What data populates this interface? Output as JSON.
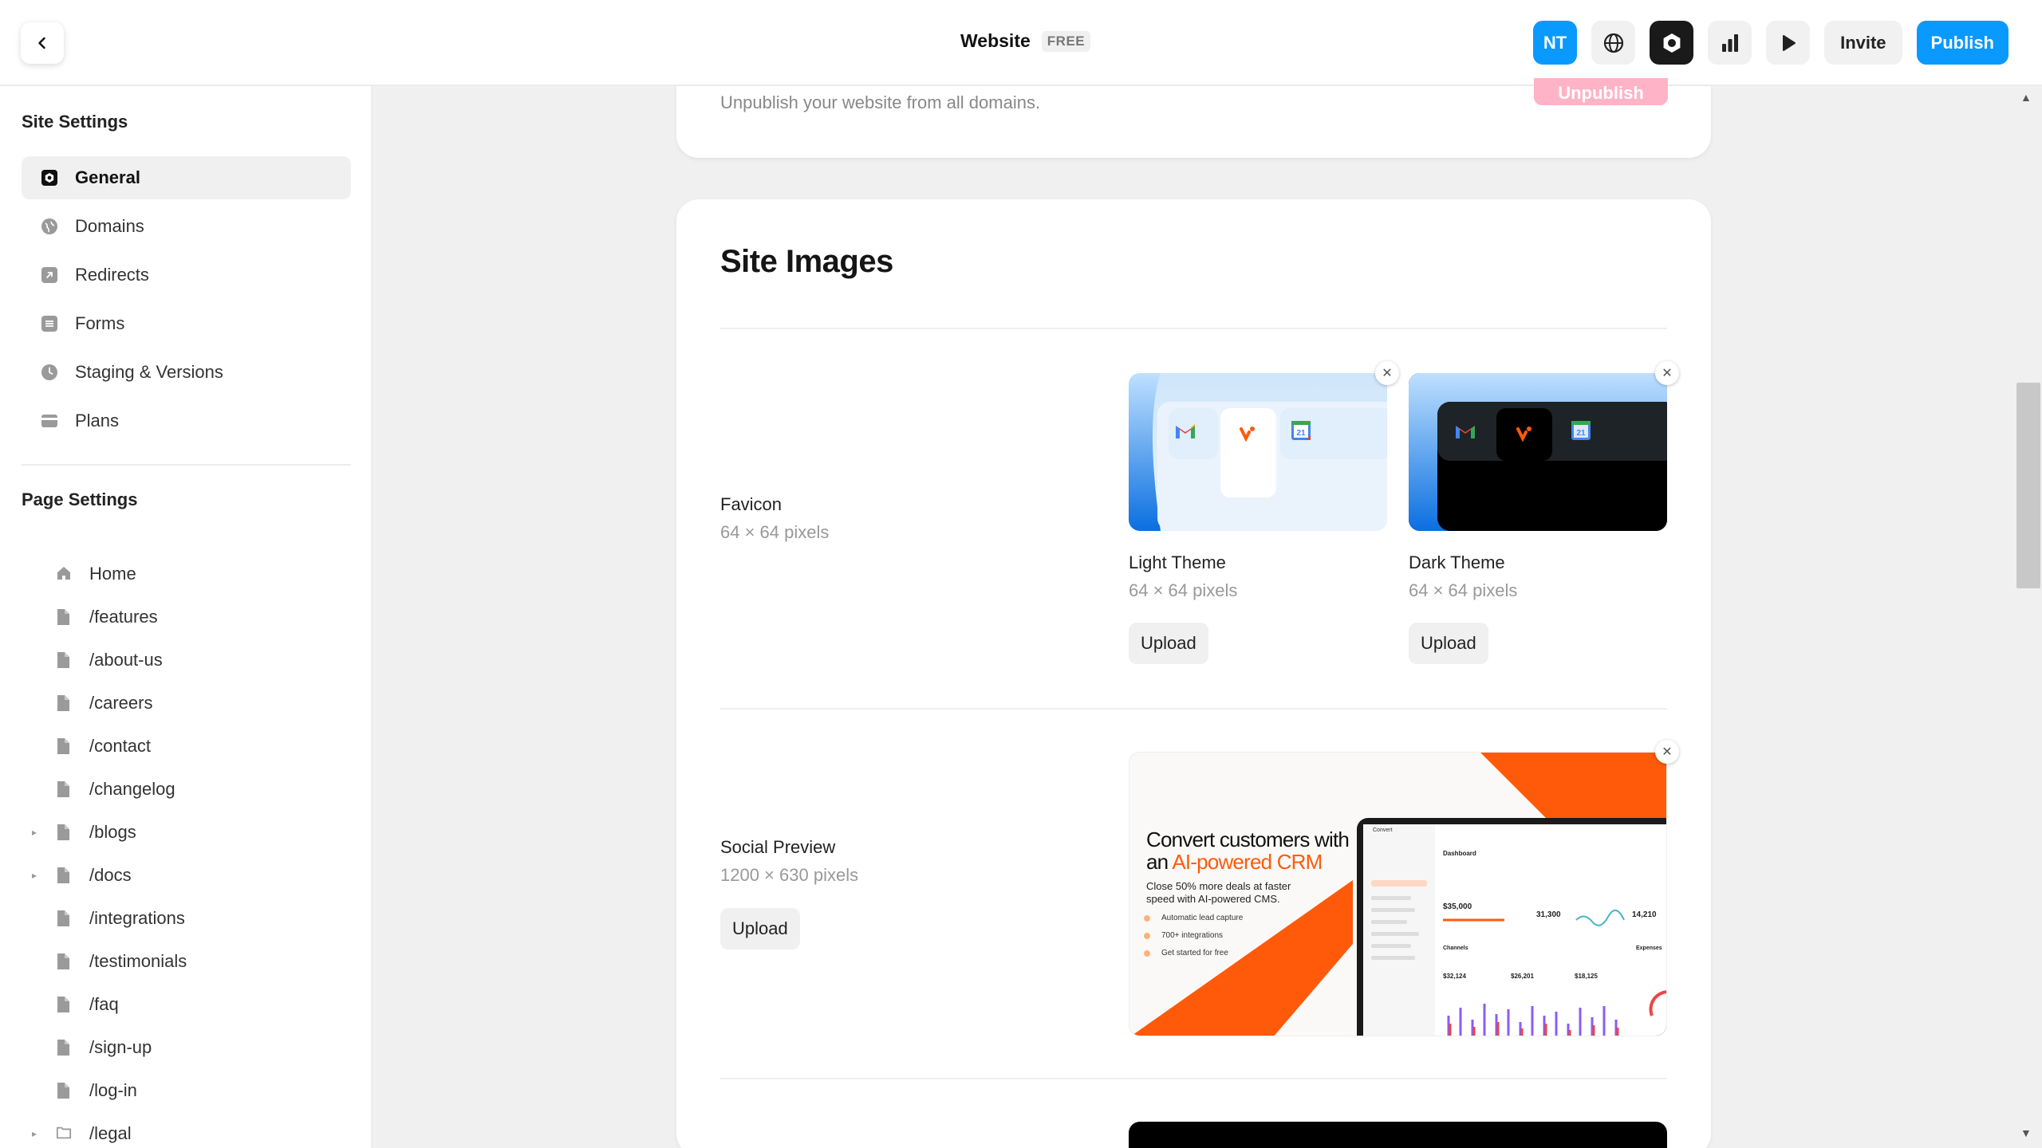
{
  "topbar": {
    "title": "Website",
    "plan_badge": "FREE",
    "avatar_initials": "NT",
    "invite_label": "Invite",
    "publish_label": "Publish"
  },
  "sidebar": {
    "site_settings_title": "Site Settings",
    "site_items": [
      {
        "label": "General",
        "icon": "gear-icon",
        "active": true
      },
      {
        "label": "Domains",
        "icon": "globe-icon"
      },
      {
        "label": "Redirects",
        "icon": "redirect-icon"
      },
      {
        "label": "Forms",
        "icon": "form-icon"
      },
      {
        "label": "Staging & Versions",
        "icon": "clock-icon"
      },
      {
        "label": "Plans",
        "icon": "card-icon"
      }
    ],
    "page_settings_title": "Page Settings",
    "pages": [
      {
        "label": "Home",
        "icon": "home-icon",
        "expandable": false
      },
      {
        "label": "/features",
        "icon": "page-icon",
        "expandable": false
      },
      {
        "label": "/about-us",
        "icon": "page-icon",
        "expandable": false
      },
      {
        "label": "/careers",
        "icon": "page-icon",
        "expandable": false
      },
      {
        "label": "/contact",
        "icon": "page-icon",
        "expandable": false
      },
      {
        "label": "/changelog",
        "icon": "page-icon",
        "expandable": false
      },
      {
        "label": "/blogs",
        "icon": "page-icon",
        "expandable": true
      },
      {
        "label": "/docs",
        "icon": "page-icon",
        "expandable": true
      },
      {
        "label": "/integrations",
        "icon": "page-icon",
        "expandable": false
      },
      {
        "label": "/testimonials",
        "icon": "page-icon",
        "expandable": false
      },
      {
        "label": "/faq",
        "icon": "page-icon",
        "expandable": false
      },
      {
        "label": "/sign-up",
        "icon": "page-icon",
        "expandable": false
      },
      {
        "label": "/log-in",
        "icon": "page-icon",
        "expandable": false
      },
      {
        "label": "/legal",
        "icon": "folder-icon",
        "expandable": true
      }
    ]
  },
  "unpublish": {
    "description": "Unpublish your website from all domains.",
    "button_label": "Unpublish"
  },
  "site_images": {
    "title": "Site Images",
    "favicon": {
      "label": "Favicon",
      "size": "64 × 64 pixels",
      "light": {
        "label": "Light Theme",
        "size": "64 × 64 pixels",
        "upload": "Upload"
      },
      "dark": {
        "label": "Dark Theme",
        "size": "64 × 64 pixels",
        "upload": "Upload"
      }
    },
    "social": {
      "label": "Social Preview",
      "size": "1200 × 630 pixels",
      "upload": "Upload",
      "preview": {
        "headline_1": "Convert customers with",
        "headline_2a": "an ",
        "headline_2b": "AI-powered CRM",
        "subline_1": "Close 50% more deals at faster",
        "subline_2": "speed with AI-powered CMS.",
        "bullets": [
          "Automatic lead capture",
          "700+ integrations",
          "Get started for free"
        ],
        "dashboard": {
          "app_name": "Convert",
          "heading": "Dashboard",
          "stat_1": "$35,000",
          "stat_2": "31,300",
          "stat_3": "14,210",
          "channels_title": "Channels",
          "ch_1": "$32,124",
          "ch_2": "$26,201",
          "ch_3": "$18,125",
          "expenses_title": "Expenses"
        }
      }
    },
    "calendar_day": "21"
  },
  "colors": {
    "accent": "#0a99ff",
    "unpublish": "#ffb3c6",
    "crm_orange": "#ff5a0a"
  }
}
